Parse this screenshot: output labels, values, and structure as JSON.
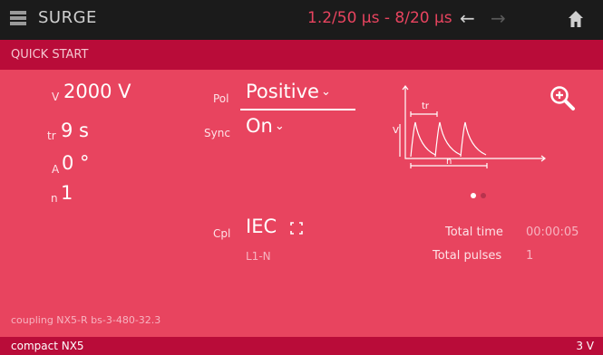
{
  "header": {
    "app_title": "SURGE",
    "waveform": "1.2/50 µs - 8/20 µs",
    "back_icon": "arrow-left-icon",
    "forward_icon": "arrow-right-icon",
    "home_icon": "home-icon",
    "menu_icon": "menu-icon"
  },
  "subheader": {
    "title": "QUICK START"
  },
  "params": {
    "voltage": {
      "label": "V",
      "value": "2000 V"
    },
    "tr": {
      "label": "tr",
      "value": "9 s"
    },
    "angle": {
      "label": "A",
      "value": "0 °"
    },
    "count": {
      "label": "n",
      "value": "1"
    }
  },
  "settings": {
    "polarity": {
      "label": "Pol",
      "value": "Positive"
    },
    "sync": {
      "label": "Sync",
      "value": "On"
    },
    "coupling": {
      "label": "Cpl",
      "value": "IEC",
      "sub": "L1-N",
      "expand_icon": "expand-icon"
    }
  },
  "diagram": {
    "v_label": "V",
    "tr_label": "tr",
    "n_label": "n",
    "zoom_icon": "zoom-in-icon"
  },
  "pager": {
    "pages": 2,
    "active": 1
  },
  "stats": {
    "total_time_label": "Total time",
    "total_time": "00:00:05",
    "total_pulses_label": "Total pulses",
    "total_pulses": "1"
  },
  "footer": {
    "coupling_note": "coupling NX5-R bs-3-480-32.3",
    "device": "compact NX5",
    "status_voltage": "3 V"
  },
  "colors": {
    "accent": "#e8445f",
    "dark": "#1b1b1b",
    "bar": "#b90c39"
  }
}
